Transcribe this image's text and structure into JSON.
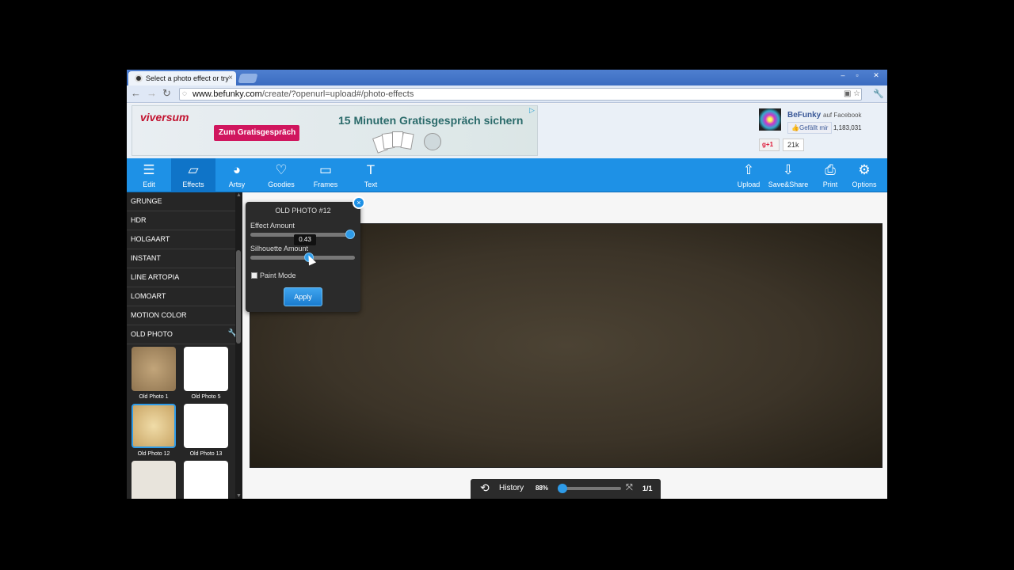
{
  "browser": {
    "tab_title": "Select a photo effect or try",
    "tab_close": "×",
    "url_host": "www.befunky.com",
    "url_path": "/create/?openurl=upload#/photo-effects",
    "window_controls": [
      "–",
      "▫",
      "✕"
    ]
  },
  "ad": {
    "brand": "viversum",
    "button": "Zum Gratisgespräch",
    "headline": "15 Minuten Gratisgespräch sichern",
    "marker": "▷"
  },
  "social": {
    "name": "BeFunky",
    "sub": "auf Facebook",
    "like": "Gefällt mir",
    "like_count": "1,183,031",
    "gplus": "+1",
    "gplus_count": "21k"
  },
  "toolbar": {
    "left": [
      {
        "label": "Edit",
        "icon": "sliders-icon",
        "glyph": "☰"
      },
      {
        "label": "Effects",
        "icon": "photos-icon",
        "glyph": "▱"
      },
      {
        "label": "Artsy",
        "icon": "palette-icon",
        "glyph": "◕"
      },
      {
        "label": "Goodies",
        "icon": "heart-icon",
        "glyph": "♡"
      },
      {
        "label": "Frames",
        "icon": "frame-icon",
        "glyph": "▭"
      },
      {
        "label": "Text",
        "icon": "text-icon",
        "glyph": "T"
      }
    ],
    "right": [
      {
        "label": "Upload",
        "icon": "upload-icon",
        "glyph": "⇧"
      },
      {
        "label": "Save&Share",
        "icon": "download-icon",
        "glyph": "⇩"
      },
      {
        "label": "Print",
        "icon": "print-icon",
        "glyph": "⎙"
      },
      {
        "label": "Options",
        "icon": "gear-icon",
        "glyph": "⚙"
      }
    ],
    "active": "Effects"
  },
  "sidebar": {
    "categories": [
      "GRUNGE",
      "HDR",
      "HOLGAART",
      "INSTANT",
      "LINE ARTOPIA",
      "LOMOART",
      "MOTION COLOR",
      "OLD PHOTO"
    ],
    "thumbs": [
      {
        "label": "Old Photo 1"
      },
      {
        "label": "Old Photo 5"
      },
      {
        "label": "Old Photo 12"
      },
      {
        "label": "Old Photo 13"
      },
      {
        "label": ""
      },
      {
        "label": ""
      }
    ]
  },
  "panel": {
    "title": "OLD PHOTO #12",
    "effect_label": "Effect Amount",
    "effect_value": 1.0,
    "tooltip": "0.43",
    "silhouette_label": "Silhouette Amount",
    "silhouette_value": 0.57,
    "paint_mode": "Paint Mode",
    "apply": "Apply",
    "close": "×"
  },
  "history": {
    "label": "History",
    "zoom": "88%",
    "page": "1/1"
  },
  "colors": {
    "accent": "#1e91e6",
    "sidebar_bg": "#262626"
  }
}
